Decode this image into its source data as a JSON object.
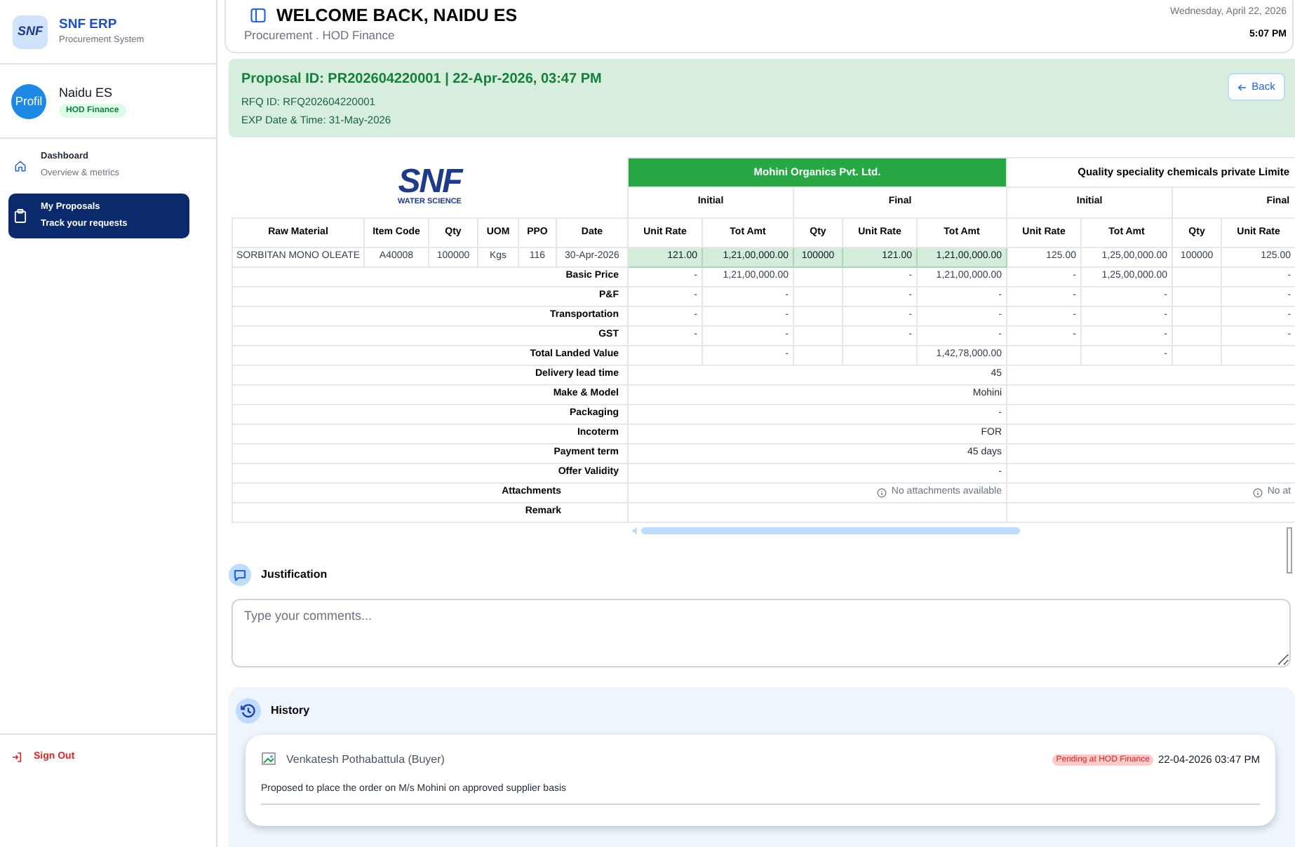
{
  "sidebar": {
    "logo": {
      "mark": "SNF",
      "title": "SNF ERP",
      "subtitle": "Procurement System"
    },
    "user": {
      "avatar_text": "Profil",
      "name": "Naidu ES",
      "role": "HOD Finance"
    },
    "nav": [
      {
        "title": "Dashboard",
        "subtitle": "Overview & metrics",
        "selected": false
      },
      {
        "title": "My Proposals",
        "subtitle": "Track your requests",
        "selected": true
      }
    ],
    "sign_out": "Sign Out"
  },
  "header": {
    "title": "WELCOME BACK, NAIDU ES",
    "subtitle": "Procurement . HOD Finance",
    "date": "Wednesday, April 22, 2026",
    "time": "5:07 PM"
  },
  "proposal": {
    "title": "Proposal ID: PR202604220001 | 22-Apr-2026, 03:47 PM",
    "rfq": "RFQ ID: RFQ202604220001",
    "expiry": "EXP Date & Time: 31-May-2026",
    "back_button": "Back"
  },
  "comparison": {
    "logo": {
      "mark": "SNF",
      "tagline": "WATER SCIENCE"
    },
    "item_columns": [
      "Raw Material",
      "Item Code",
      "Qty",
      "UOM",
      "PPO",
      "Date"
    ],
    "suppliers": [
      {
        "name": "Mohini Organics Pvt. Ltd.",
        "selected": true,
        "groups": [
          {
            "label": "Initial",
            "columns": [
              "Unit Rate",
              "Tot Amt"
            ]
          },
          {
            "label": "Final",
            "columns": [
              "Qty",
              "Unit Rate",
              "Tot Amt"
            ]
          }
        ]
      },
      {
        "name": "Quality speciality chemicals private Limite",
        "selected": false,
        "groups": [
          {
            "label": "Initial",
            "columns": [
              "Unit Rate",
              "Tot Amt"
            ]
          },
          {
            "label": "Final",
            "columns": [
              "Qty",
              "Unit Rate"
            ]
          }
        ]
      }
    ],
    "item_row": {
      "cells": [
        "SORBITAN MONO OLEATE",
        "A40008",
        "100000",
        "Kgs",
        "116",
        "30-Apr-2026"
      ],
      "quotes": [
        {
          "initial_unit_rate": "121.00",
          "initial_tot_amt": "1,21,00,000.00",
          "final_qty": "100000",
          "final_unit_rate": "121.00",
          "final_tot_amt": "1,21,00,000.00"
        },
        {
          "initial_unit_rate": "125.00",
          "initial_tot_amt": "1,25,00,000.00",
          "final_qty": "100000",
          "final_unit_rate": "125.00"
        }
      ]
    },
    "rows": [
      {
        "kind": "charge",
        "label": "Basic Price",
        "quotes": [
          {
            "initial_unit_rate": "-",
            "initial_tot_amt": "1,21,00,000.00",
            "final_unit_rate": "-",
            "final_tot_amt": "1,21,00,000.00"
          },
          {
            "initial_unit_rate": "-",
            "initial_tot_amt": "1,25,00,000.00",
            "final_unit_rate": "-"
          }
        ]
      },
      {
        "kind": "charge",
        "label": "P&F",
        "quotes": [
          {
            "initial_unit_rate": "-",
            "initial_tot_amt": "-",
            "final_unit_rate": "-",
            "final_tot_amt": "-"
          },
          {
            "initial_unit_rate": "-",
            "initial_tot_amt": "-",
            "final_unit_rate": "-"
          }
        ]
      },
      {
        "kind": "charge",
        "label": "Transportation",
        "quotes": [
          {
            "initial_unit_rate": "-",
            "initial_tot_amt": "-",
            "final_unit_rate": "-",
            "final_tot_amt": "-"
          },
          {
            "initial_unit_rate": "-",
            "initial_tot_amt": "-",
            "final_unit_rate": "-"
          }
        ]
      },
      {
        "kind": "charge",
        "label": "GST",
        "quotes": [
          {
            "initial_unit_rate": "-",
            "initial_tot_amt": "-",
            "final_unit_rate": "-",
            "final_tot_amt": "-"
          },
          {
            "initial_unit_rate": "-",
            "initial_tot_amt": "-",
            "final_unit_rate": "-"
          }
        ]
      },
      {
        "kind": "charge",
        "label": "Total Landed Value",
        "quotes": [
          {
            "initial_tot_amt": "-",
            "final_tot_amt": "1,42,78,000.00"
          },
          {
            "initial_tot_amt": "-"
          }
        ]
      },
      {
        "kind": "term",
        "label": "Delivery lead time",
        "values": [
          "45"
        ]
      },
      {
        "kind": "term",
        "label": "Make & Model",
        "values": [
          "Mohini"
        ]
      },
      {
        "kind": "term",
        "label": "Packaging",
        "values": [
          "-"
        ]
      },
      {
        "kind": "term",
        "label": "Incoterm",
        "values": [
          "FOR"
        ]
      },
      {
        "kind": "term",
        "label": "Payment term",
        "values": [
          "45 days"
        ]
      },
      {
        "kind": "term",
        "label": "Offer Validity",
        "values": [
          "-"
        ]
      },
      {
        "kind": "attachments",
        "label": "Attachments",
        "values": [
          "No attachments available",
          "No at"
        ]
      },
      {
        "kind": "remark",
        "label": "Remark"
      }
    ]
  },
  "justification": {
    "title": "Justification",
    "placeholder": "Type your comments..."
  },
  "history": {
    "title": "History",
    "entries": [
      {
        "author": "Venkatesh Pothabattula (Buyer)",
        "status": "Pending at HOD Finance",
        "time": "22-04-2026 03:47 PM",
        "note": "Proposed to place the order on M/s Mohini on approved supplier basis"
      }
    ]
  }
}
